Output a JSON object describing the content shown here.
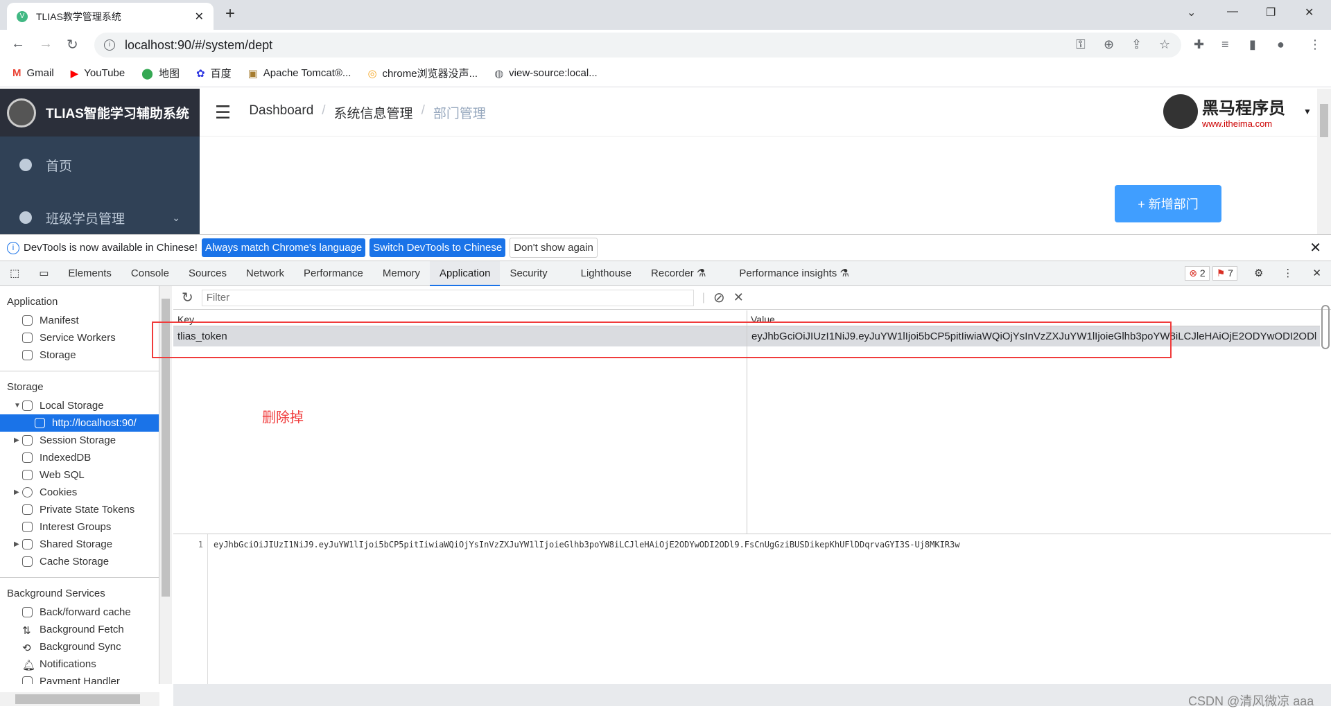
{
  "browser": {
    "tab_title": "TLIAS教学管理系统",
    "url": "localhost:90/#/system/dept",
    "bookmarks": [
      "Gmail",
      "YouTube",
      "地图",
      "百度",
      "Apache Tomcat®...",
      "chrome浏览器没声...",
      "view-source:local..."
    ]
  },
  "app": {
    "title": "TLIAS智能学习辅助系统",
    "menu": [
      "首页",
      "班级学员管理"
    ],
    "breadcrumb": [
      "Dashboard",
      "系统信息管理",
      "部门管理"
    ],
    "brand": {
      "name": "黑马程序员",
      "site": "www.itheima.com"
    },
    "add_button": "+ 新增部门"
  },
  "devtools": {
    "infobar": {
      "message": "DevTools is now available in Chinese!",
      "btn1": "Always match Chrome's language",
      "btn2": "Switch DevTools to Chinese",
      "btn3": "Don't show again"
    },
    "tabs": [
      "Elements",
      "Console",
      "Sources",
      "Network",
      "Performance",
      "Memory",
      "Application",
      "Security",
      "Lighthouse",
      "Recorder ⚗",
      "Performance insights ⚗"
    ],
    "active_tab": "Application",
    "errors": "2",
    "warnings": "7",
    "sidebar": {
      "application_title": "Application",
      "application_items": [
        "Manifest",
        "Service Workers",
        "Storage"
      ],
      "storage_title": "Storage",
      "storage_items": [
        "Local Storage",
        "http://localhost:90/",
        "Session Storage",
        "IndexedDB",
        "Web SQL",
        "Cookies",
        "Private State Tokens",
        "Interest Groups",
        "Shared Storage",
        "Cache Storage"
      ],
      "bg_title": "Background Services",
      "bg_items": [
        "Back/forward cache",
        "Background Fetch",
        "Background Sync",
        "Notifications",
        "Payment Handler"
      ]
    },
    "filter_placeholder": "Filter",
    "table": {
      "headers": [
        "Key",
        "Value"
      ],
      "row": {
        "key": "tlias_token",
        "value": "eyJhbGciOiJIUzI1NiJ9.eyJuYW1lIjoi5bCP5pitIiwiaWQiOjYsInVzZXJuYW1lIjoieGlhb3poYW8iLCJleHAiOjE2ODYwODI2ODl9.Fs..."
      }
    },
    "preview": {
      "line": "1",
      "code": "eyJhbGciOiJIUzI1NiJ9.eyJuYW1lIjoi5bCP5pitIiwiaWQiOjYsInVzZXJuYW1lIjoieGlhb3poYW8iLCJleHAiOjE2ODYwODI2ODl9.FsCnUgGziBUSDikepKhUFlDDqrvaGYI3S-Uj8MKIR3w"
    },
    "annotation": "删除掉"
  },
  "watermark": "CSDN @清风微凉 aaa"
}
